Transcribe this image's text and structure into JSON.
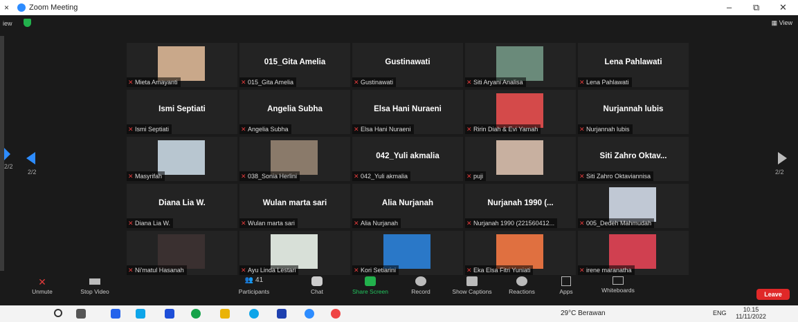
{
  "window": {
    "title": "Zoom Meeting",
    "close": "×",
    "minimize": "–",
    "restore": "⧉",
    "close_main": "✕"
  },
  "header": {
    "view_left": "iew",
    "view_right": "View"
  },
  "nav": {
    "left_page": "2/2",
    "right_page": "2/2",
    "edge_page": "2/2"
  },
  "tiles": [
    {
      "name": "Mieta Amayanti",
      "big": "",
      "avatar": "#c9a88a"
    },
    {
      "name": "015_Gita Amelia",
      "big": "015_Gita Amelia",
      "avatar": ""
    },
    {
      "name": "Gustinawati",
      "big": "Gustinawati",
      "avatar": ""
    },
    {
      "name": "Siti Aryani Analisa",
      "big": "",
      "avatar": "#6a8a7a"
    },
    {
      "name": "Lena Pahlawati",
      "big": "Lena Pahlawati",
      "avatar": ""
    },
    {
      "name": "Ismi Septiati",
      "big": "Ismi Septiati",
      "avatar": ""
    },
    {
      "name": "Angelia Subha",
      "big": "Angelia Subha",
      "avatar": ""
    },
    {
      "name": "Elsa Hani Nuraeni",
      "big": "Elsa Hani Nuraeni",
      "avatar": ""
    },
    {
      "name": "Ririn Diah & Evi Yamah",
      "big": "",
      "avatar": "#d44a4a"
    },
    {
      "name": "Nurjannah lubis",
      "big": "Nurjannah lubis",
      "avatar": ""
    },
    {
      "name": "Masyrifah",
      "big": "",
      "avatar": "#b8c6d0"
    },
    {
      "name": "038_Sonia Herlini",
      "big": "",
      "avatar": "#8a7a6a"
    },
    {
      "name": "042_Yuli akmalia",
      "big": "042_Yuli akmalia",
      "avatar": ""
    },
    {
      "name": "puji",
      "big": "",
      "avatar": "#c8b0a0"
    },
    {
      "name": "Siti Zahro Oktaviannisa",
      "big": "Siti Zahro Oktav...",
      "avatar": ""
    },
    {
      "name": "Diana Lia W.",
      "big": "Diana Lia W.",
      "avatar": ""
    },
    {
      "name": "Wulan marta sari",
      "big": "Wulan marta sari",
      "avatar": ""
    },
    {
      "name": "Alia Nurjanah",
      "big": "Alia Nurjanah",
      "avatar": ""
    },
    {
      "name": "Nurjanah 1990 (221560412...",
      "big": "Nurjanah 1990 (...",
      "avatar": ""
    },
    {
      "name": "005_Dedeh Mahmudah",
      "big": "",
      "avatar": "#c0c8d4"
    },
    {
      "name": "Ni'matul Hasanah",
      "big": "",
      "avatar": "#3a3030"
    },
    {
      "name": "Ayu Linda Lestari",
      "big": "",
      "avatar": "#d8e0d8"
    },
    {
      "name": "Kori Setiarini",
      "big": "",
      "avatar": "#2a78c8"
    },
    {
      "name": "Eka Elsa Fitri Yuniati",
      "big": "",
      "avatar": "#e07040"
    },
    {
      "name": "irene maranatha",
      "big": "",
      "avatar": "#d04050"
    }
  ],
  "toolbar": {
    "unmute": "Unmute",
    "stop_video": "Stop Video",
    "participants": "Participants",
    "participants_count": "41",
    "chat": "Chat",
    "share": "Share Screen",
    "record": "Record",
    "captions": "Show Captions",
    "reactions": "Reactions",
    "apps": "Apps",
    "whiteboards": "Whiteboards",
    "leave": "Leave"
  },
  "taskbar": {
    "weather": "29°C Berawan",
    "lang": "ENG",
    "time": "10.15",
    "date": "11/11/2022"
  }
}
